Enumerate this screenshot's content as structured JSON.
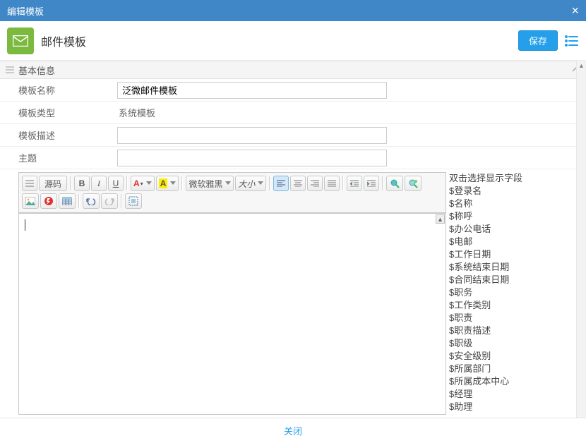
{
  "window": {
    "title": "编辑模板",
    "close_label": "×"
  },
  "header": {
    "title": "邮件模板",
    "save_label": "保存"
  },
  "section": {
    "title": "基本信息"
  },
  "form": {
    "name_label": "模板名称",
    "name_value": "泛微邮件模板",
    "type_label": "模板类型",
    "type_value": "系统模板",
    "desc_label": "模板描述",
    "desc_value": "",
    "subject_label": "主题",
    "subject_value": ""
  },
  "toolbar": {
    "source": "源码",
    "bold": "B",
    "italic": "I",
    "underline": "U",
    "fg_a": "A",
    "bg_a": "A",
    "font_family": "微软雅黑",
    "font_size": "大小"
  },
  "fields": {
    "header": "双击选择显示字段",
    "items": [
      "$登录名",
      "$名称",
      "$称呼",
      "$办公电话",
      "$电邮",
      "$工作日期",
      "$系统结束日期",
      "$合同结束日期",
      "$职务",
      "$工作类别",
      "$职责",
      "$职责描述",
      "$职级",
      "$安全级别",
      "$所属部门",
      "$所属成本中心",
      "$经理",
      "$助理"
    ]
  },
  "footer": {
    "close_label": "关闭"
  }
}
